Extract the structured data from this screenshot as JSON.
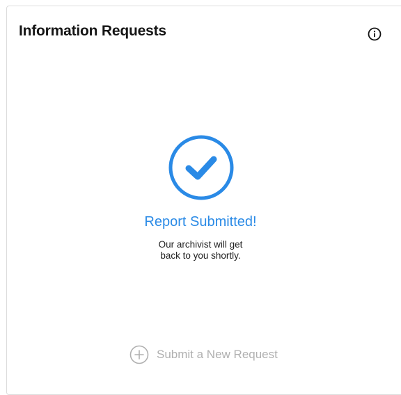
{
  "panel": {
    "title": "Information Requests",
    "info_icon": "info-circle-icon"
  },
  "status": {
    "icon": "check-circle-icon",
    "title": "Report Submitted!",
    "message": "Our archivist will get back to you shortly."
  },
  "actions": {
    "new_request_icon": "plus-circle-icon",
    "new_request_label": "Submit a New Request"
  },
  "colors": {
    "accent": "#2a8ae6",
    "muted": "#b0b0b0",
    "title": "#151515"
  }
}
